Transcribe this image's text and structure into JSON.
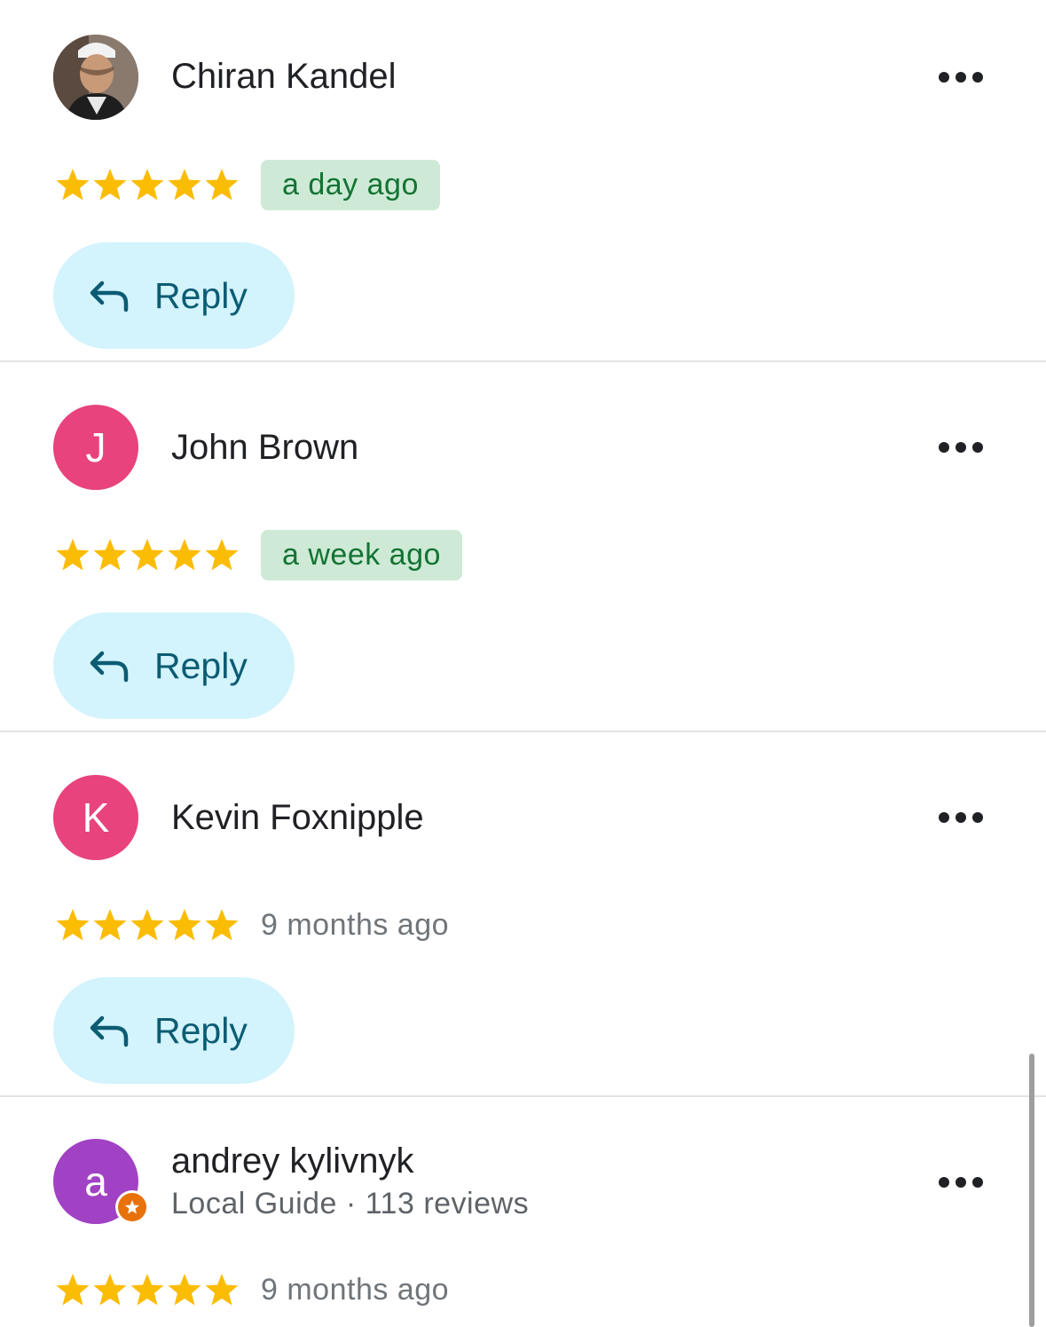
{
  "colors": {
    "star": "#fbbc04",
    "badge_bg": "#ceead6",
    "badge_text": "#137333",
    "reply_bg": "#d3f3fd",
    "reply_text": "#0b5c73",
    "avatar_pink": "#e8437c",
    "avatar_purple": "#a142c4",
    "local_guide_orange": "#e8710a"
  },
  "reply_label": "Reply",
  "reviews": [
    {
      "name": "Chiran Kandel",
      "avatar": "photo",
      "rating": 5,
      "time": "a day ago",
      "time_highlight": true
    },
    {
      "name": "John Brown",
      "avatar_letter": "J",
      "rating": 5,
      "time": "a week ago",
      "time_highlight": true
    },
    {
      "name": "Kevin Foxnipple",
      "avatar_letter": "K",
      "rating": 5,
      "time": "9 months ago",
      "time_highlight": false
    },
    {
      "name": "andrey kylivnyk",
      "avatar_letter": "a",
      "subtitle": "Local Guide · 113 reviews",
      "rating": 5,
      "time": "9 months ago",
      "time_highlight": false
    }
  ],
  "icons": {
    "more": "more-horizontal-icon",
    "reply": "reply-arrow-icon",
    "star": "star-icon",
    "local_guide": "local-guide-badge-icon"
  }
}
